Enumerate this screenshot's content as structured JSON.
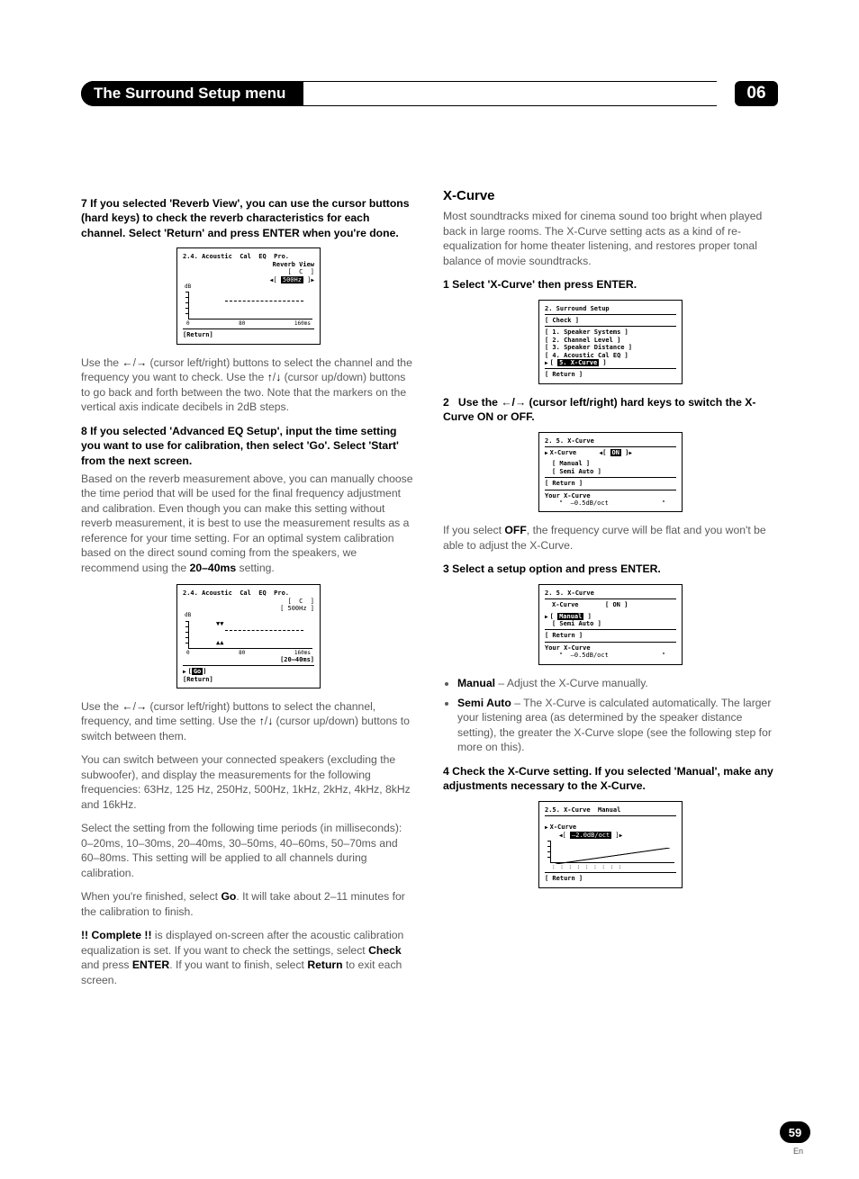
{
  "chapter": {
    "title": "The Surround Setup menu",
    "number": "06"
  },
  "left": {
    "step7": "7   If you selected 'Reverb View', you can use the cursor buttons (hard keys) to check the reverb characteristics for each channel. Select 'Return' and press ENTER when you're done.",
    "osd1": {
      "title": "2.4. Acoustic  Cal  EQ  Pro.",
      "sub": "Reverb View",
      "ch": "[  C  ]",
      "freq": "500Hz",
      "ax0": "0",
      "ax80": "80",
      "ax160": "160ms",
      "return": "[Return]"
    },
    "p1": "Use the ←/→ (cursor left/right) buttons to select the channel and the frequency you want to check. Use the ↑/↓ (cursor up/down) buttons to go back and forth between the two. Note that the markers on the vertical axis indicate decibels in 2dB steps.",
    "step8": "8   If you selected 'Advanced EQ Setup', input the time setting you want to use for calibration, then select 'Go'. Select 'Start' from the next screen.",
    "p2": "Based on the reverb measurement above, you can manually choose the time period that will be used for the final frequency adjustment and calibration. Even though you can make this setting without reverb measurement, it is best to use the measurement results as a reference for your time setting. For an optimal system calibration based on the direct sound coming from the speakers, we recommend using the ",
    "p2b": "20–40ms",
    "p2c": " setting.",
    "osd2": {
      "title": "2.4. Acoustic  Cal  EQ  Pro.",
      "ch": "[  C  ]",
      "freq": "[ 500Hz ]",
      "ax0": "0",
      "ax80": "80",
      "ax160": "160ms",
      "time": "[20–40ms]",
      "go": "Go",
      "return": "[Return]"
    },
    "p3": "Use the ←/→ (cursor left/right) buttons to select the channel, frequency, and time setting. Use the ↑/↓ (cursor up/down) buttons to switch between them.",
    "p4": "You can switch between your connected speakers (excluding the subwoofer), and display the measurements for the following frequencies: 63Hz, 125 Hz, 250Hz, 500Hz, 1kHz, 2kHz, 4kHz, 8kHz and 16kHz.",
    "p5": "Select the setting from the following time periods (in milliseconds): 0–20ms, 10–30ms, 20–40ms, 30–50ms, 40–60ms, 50–70ms and 60–80ms. This setting will be applied to all channels during calibration.",
    "p6a": "When you're finished, select ",
    "p6b": "Go",
    "p6c": ". It will take about 2–11 minutes for the calibration to finish.",
    "p7a": "!! Complete !!",
    "p7b": " is displayed on-screen after the acoustic calibration equalization is set. If you want to check the settings, select ",
    "p7c": "Check",
    "p7d": " and press ",
    "p7e": "ENTER",
    "p7f": ". If you want to finish, select ",
    "p7g": "Return",
    "p7h": " to exit each screen."
  },
  "right": {
    "h": "X-Curve",
    "intro": "Most soundtracks mixed for cinema sound too bright when played back in large rooms. The X-Curve setting acts as a kind of re-equalization for home theater listening, and restores proper tonal balance of movie soundtracks.",
    "s1": "1   Select 'X-Curve' then press ENTER.",
    "osd3": {
      "title": "2. Surround Setup",
      "check": "[ Check ]",
      "i1": "[ 1. Speaker Systems ]",
      "i2": "[ 2. Channel Level ]",
      "i3": "[ 3. Speaker Distance ]",
      "i4": "[ 4. Acoustic Cal EQ ]",
      "i5": "5. X-Curve",
      "return": "[ Return ]"
    },
    "s2": "2   Use the ←/→ (cursor left/right) hard keys to switch the X-Curve ON or OFF.",
    "osd4": {
      "title": "2. 5. X-Curve",
      "xcurve": "X-Curve",
      "on": "ON",
      "manual": "[ Manual ]",
      "semi": "[ Semi Auto ]",
      "return": "[ Return ]",
      "your": "Your X-Curve",
      "val": "–0.5dB/oct"
    },
    "p_off_a": "If you select ",
    "p_off_b": "OFF",
    "p_off_c": ", the frequency curve will be flat and you won't be able to adjust the X-Curve.",
    "s3": "3   Select a setup option and press ENTER.",
    "osd5": {
      "title": "2. 5. X-Curve",
      "xcurve": "X-Curve",
      "on": "[ ON ]",
      "manual": "Manual",
      "semi": "[ Semi Auto ]",
      "return": "[ Return ]",
      "your": "Your X-Curve",
      "val": "–0.5dB/oct"
    },
    "b1a": "Manual",
    "b1b": " – Adjust the X-Curve manually.",
    "b2a": "Semi Auto",
    "b2b": " – The X-Curve is calculated automatically. The larger your listening area (as determined by the speaker distance setting), the greater the X-Curve slope (see the following step for more on this).",
    "s4": "4   Check the X-Curve setting. If you selected 'Manual', make any adjustments necessary to the X-Curve.",
    "osd6": {
      "title": "2.5. X-Curve  Manual",
      "xcurve": "X-Curve",
      "val": "–2.0dB/oct",
      "return": "[ Return ]"
    }
  },
  "footer": {
    "page": "59",
    "lang": "En"
  }
}
